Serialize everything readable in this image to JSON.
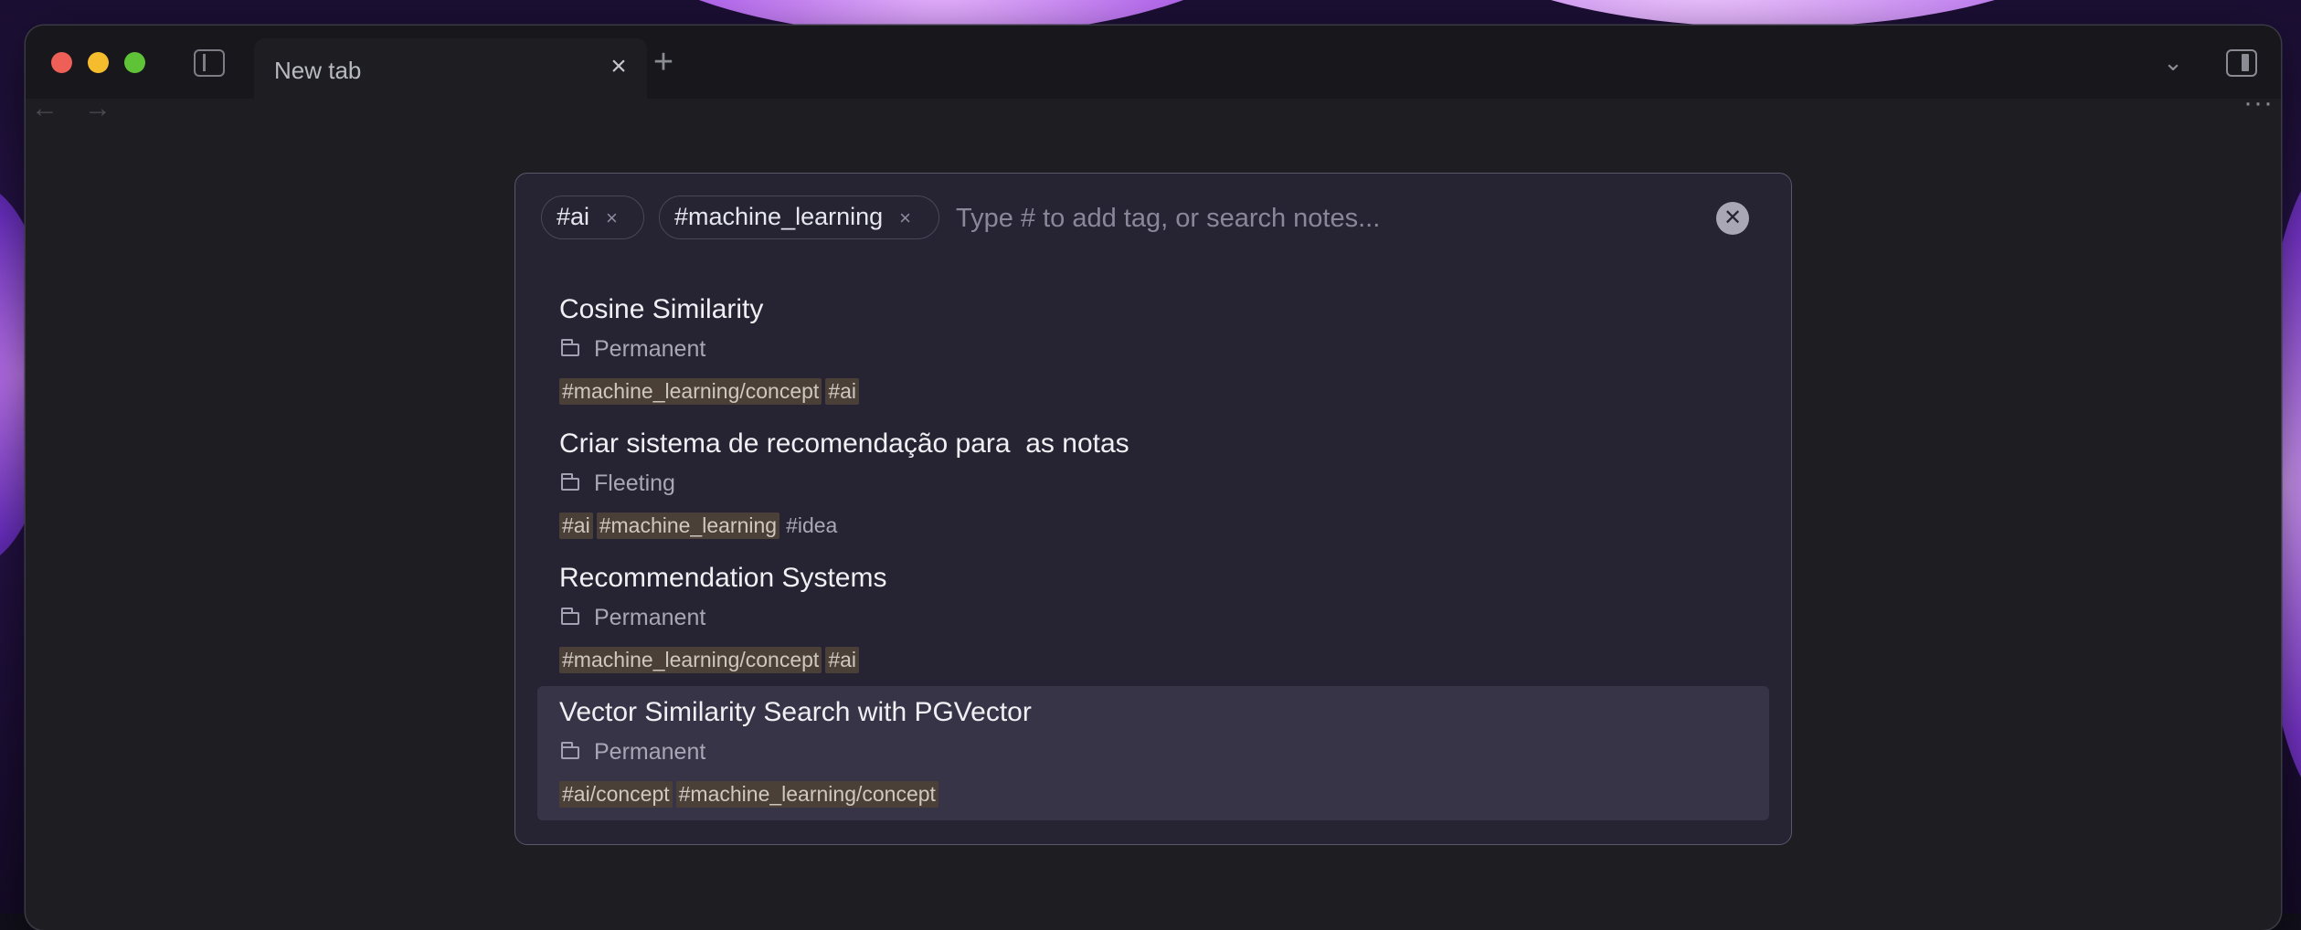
{
  "window": {
    "tab_title": "New tab"
  },
  "search": {
    "chips": [
      "#ai",
      "#machine_learning"
    ],
    "placeholder": "Type # to add tag, or search notes..."
  },
  "results": [
    {
      "title": "Cosine Similarity",
      "folder": "Permanent",
      "tags": [
        {
          "text": "#machine_learning/concept",
          "highlight": true
        },
        {
          "text": "#ai",
          "highlight": true
        }
      ]
    },
    {
      "title": "Criar sistema de recomendação para  as notas",
      "folder": "Fleeting",
      "tags": [
        {
          "text": "#ai",
          "highlight": true
        },
        {
          "text": "#machine_learning",
          "highlight": true
        },
        {
          "text": "#idea",
          "highlight": false
        }
      ]
    },
    {
      "title": "Recommendation Systems",
      "folder": "Permanent",
      "tags": [
        {
          "text": "#machine_learning/concept",
          "highlight": true
        },
        {
          "text": "#ai",
          "highlight": true
        }
      ]
    },
    {
      "title": "Vector Similarity Search with PGVector",
      "folder": "Permanent",
      "selected": true,
      "tags": [
        {
          "text": "#ai/concept",
          "highlight": true
        },
        {
          "text": "#machine_learning/concept",
          "highlight": true
        }
      ]
    }
  ],
  "icons": {
    "close": "close-icon",
    "add_tab": "plus-icon",
    "folder": "folder-icon",
    "clear": "clear-circle-icon"
  },
  "colors": {
    "accent_tag_bg": "#4b4038",
    "modal_bg": "#262433",
    "selected_row": "#363446"
  }
}
